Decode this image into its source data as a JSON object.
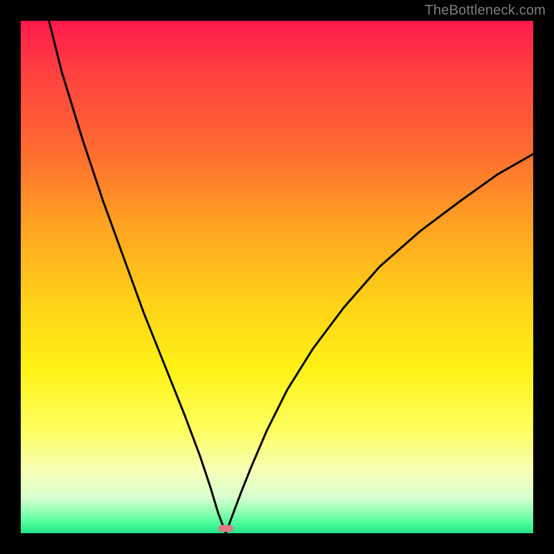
{
  "attribution": "TheBottleneck.com",
  "colors": {
    "page_bg": "#000000",
    "gradient_top": "#ff1a4d",
    "gradient_bottom": "#23e08a",
    "curve": "#000000",
    "pill": "#d97b87",
    "attribution_text": "#7f7f7f"
  },
  "chart_data": {
    "type": "line",
    "title": "",
    "xlabel": "",
    "ylabel": "",
    "xlim": [
      0,
      100
    ],
    "ylim": [
      0,
      100
    ],
    "minimum_x": 40,
    "series": [
      {
        "name": "bottleneck-curve",
        "x": [
          0,
          2,
          5,
          8,
          12,
          16,
          20,
          24,
          28,
          32,
          35,
          37,
          38.5,
          40,
          41.5,
          43,
          45,
          48,
          52,
          57,
          63,
          70,
          78,
          86,
          93,
          100
        ],
        "values": [
          125,
          115,
          102,
          90,
          77,
          65,
          54,
          43,
          33,
          23,
          15,
          9,
          4,
          0,
          4,
          8,
          13,
          20,
          28,
          36,
          44,
          52,
          59,
          65,
          70,
          74
        ]
      }
    ],
    "annotations": [
      {
        "name": "minimum-pill",
        "x": 40,
        "y": 0
      }
    ]
  }
}
